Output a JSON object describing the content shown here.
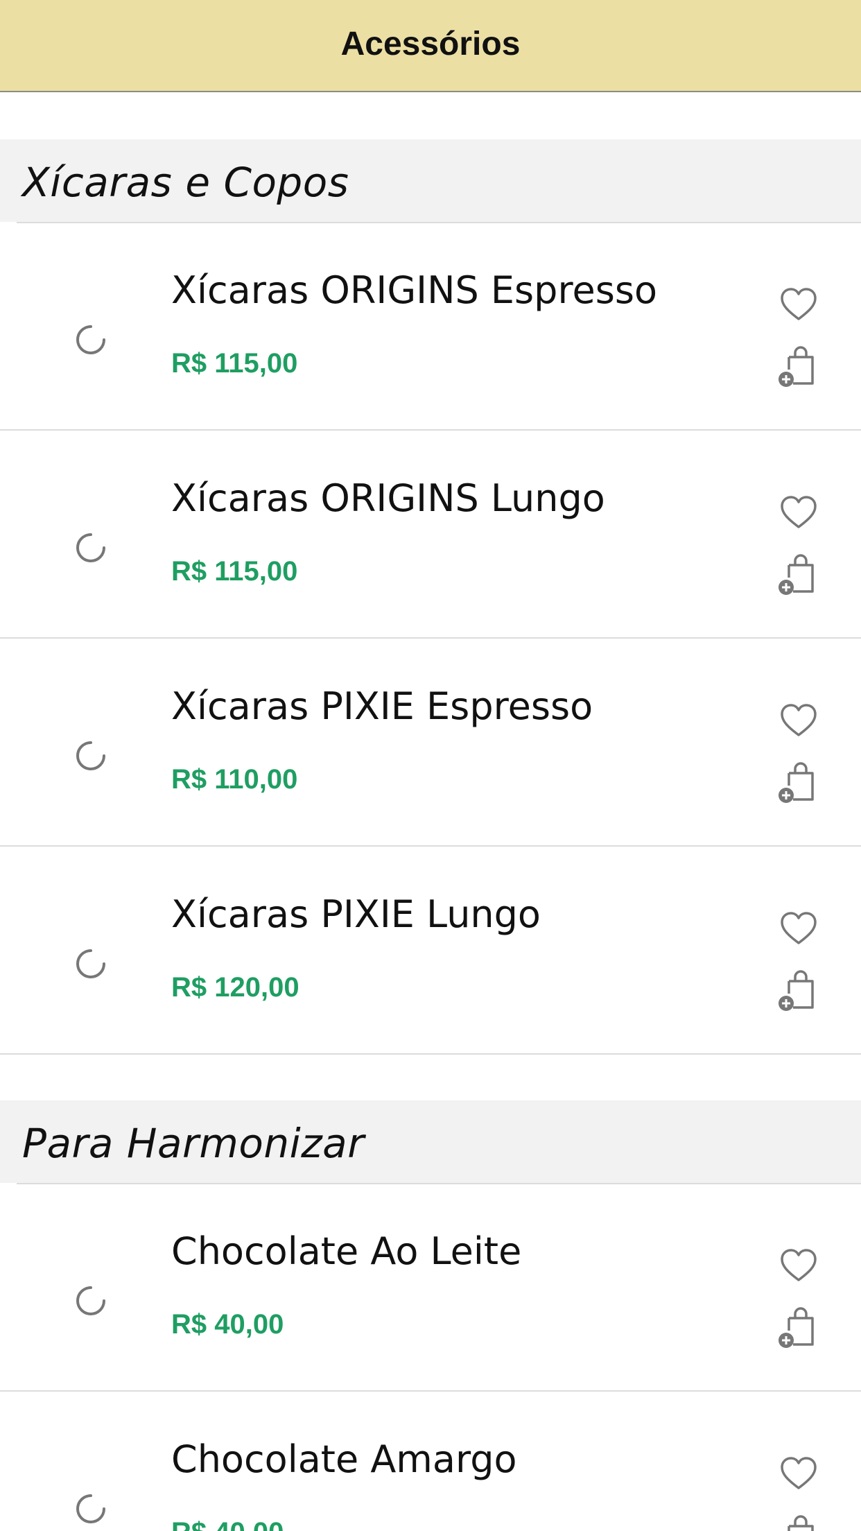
{
  "header": {
    "title": "Acessórios"
  },
  "colors": {
    "navbar": "#ecdfa4",
    "price": "#1f9e62",
    "icon": "#777777"
  },
  "icons": {
    "favorite": "heart-icon",
    "add_to_bag": "add-to-bag-icon",
    "loading": "loading-spinner-icon"
  },
  "sections": [
    {
      "title": "Xícaras e Copos",
      "items": [
        {
          "name": "Xícaras ORIGINS Espresso",
          "price": "R$ 115,00"
        },
        {
          "name": "Xícaras ORIGINS Lungo",
          "price": "R$ 115,00"
        },
        {
          "name": "Xícaras PIXIE Espresso",
          "price": "R$ 110,00"
        },
        {
          "name": "Xícaras PIXIE Lungo",
          "price": "R$ 120,00"
        }
      ]
    },
    {
      "title": "Para Harmonizar",
      "items": [
        {
          "name": "Chocolate Ao Leite",
          "price": "R$ 40,00"
        },
        {
          "name": "Chocolate Amargo",
          "price": "R$ 40,00"
        }
      ]
    }
  ]
}
